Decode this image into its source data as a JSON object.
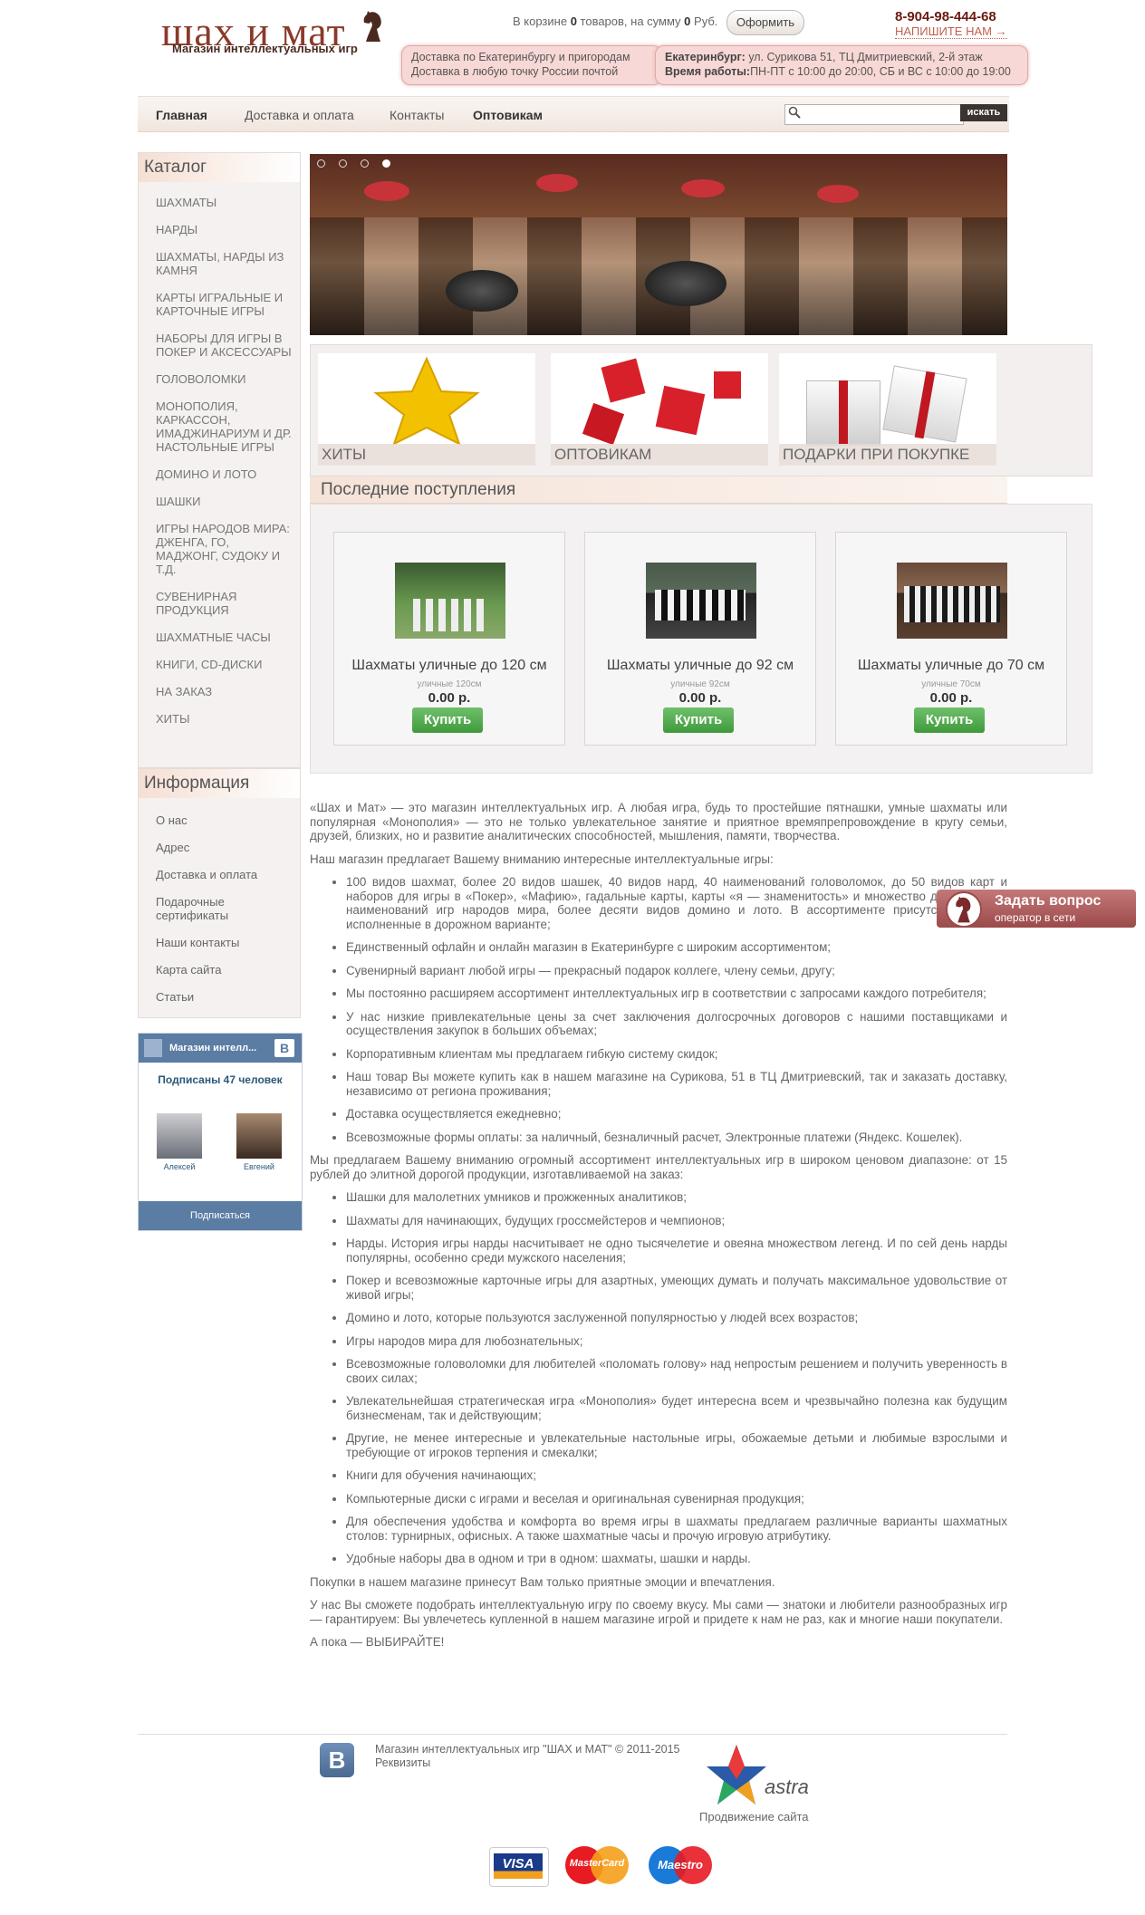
{
  "header": {
    "logo_title": "шах и мат",
    "logo_subtitle": "Магазин интеллектуальных игр",
    "cart_prefix": "В корзине ",
    "cart_count": "0",
    "cart_middle": " товаров, на сумму ",
    "cart_sum": "0",
    "cart_currency": " Руб.",
    "checkout": "Оформить",
    "phone": "8-904-98-444-68",
    "write_us": "Напишите нам →",
    "delivery_line1": "Доставка по Екатеринбургу и пригородам",
    "delivery_line2": "Доставка в любую точку России почтой",
    "address_label": "Екатеринбург:",
    "address": " ул. Сурикова 51, ТЦ Дмитриевский, 2-й этаж",
    "hours_label": "Время работы:",
    "hours": "ПН-ПТ с 10:00 до 20:00, СБ и ВС с 10:00 до 19:00"
  },
  "nav": {
    "items": [
      "Главная",
      "Доставка и оплата",
      "Контакты",
      "Оптовикам"
    ],
    "search_placeholder": "",
    "search_button": "искать"
  },
  "sidebar": {
    "catalog_title": "Каталог",
    "catalog": [
      "Шахматы",
      "Нарды",
      "Шахматы, нарды из камня",
      "Карты игральные и карточные игры",
      "Наборы для игры в покер и аксессуары",
      "Головоломки",
      "Монополия, Каркассон, Имаджинариум и др. настольные игры",
      "Домино и лото",
      "Шашки",
      "Игры народов мира: Дженга, Го, Маджонг, Судоку и т.д.",
      "Сувенирная продукция",
      "Шахматные часы",
      "Книги, CD-диски",
      "На заказ",
      "Хиты"
    ],
    "info_title": "Информация",
    "info": [
      "О нас",
      "Адрес",
      "Доставка и оплата",
      "Подарочные сертификаты",
      "Наши контакты",
      "Карта сайта",
      "Статьи"
    ],
    "vk": {
      "group": "Магазин интелл...",
      "subscribers": "Подписаны 47 человек",
      "user1": "Алексей",
      "user2": "Евгений",
      "subscribe": "Подписаться"
    }
  },
  "promos": [
    "Хиты",
    "Оптовикам",
    "Подарки при покупке"
  ],
  "latest": {
    "title": "Последние поступления",
    "products": [
      {
        "title": "Шахматы уличные до 120 см",
        "sub": "уличные 120см",
        "price": "0.00 р.",
        "buy": "Купить"
      },
      {
        "title": "Шахматы уличные до 92 см",
        "sub": "уличные 92см",
        "price": "0.00 р.",
        "buy": "Купить"
      },
      {
        "title": "Шахматы уличные до 70 см",
        "sub": "уличные 70см",
        "price": "0.00 р.",
        "buy": "Купить"
      }
    ]
  },
  "article": {
    "p1": "«Шах и Мат» — это магазин интеллектуальных игр. А любая игра, будь то простейшие пятнашки, умные шахматы или популярная «Монополия» — это не только увлекательное занятие и приятное времяпрепровождение в кругу семьи, друзей, близких, но и развитие аналитических способностей, мышления, памяти, творчества.",
    "p2": "Наш магазин предлагает Вашему вниманию интересные интеллектуальные игры:",
    "list1": [
      "100 видов шахмат, более 20 видов шашек, 40 видов нард, 40 наименований головоломок, до 50 видов карт и наборов для игры в «Покер», «Мафию», гадальные карты, карты «я — знаменитость» и множество других, до 20 наименований игр народов мира, более десяти видов домино и лото. В ассортименте присутствуют игры, исполненные в дорожном варианте;",
      "Единственный офлайн и онлайн магазин в Екатеринбурге с широким ассортиментом;",
      "Сувенирный вариант любой игры — прекрасный подарок коллеге, члену семьи, другу;",
      "Мы постоянно расширяем ассортимент интеллектуальных игр в соответствии с запросами каждого потребителя;",
      "У нас низкие привлекательные цены за счет заключения долгосрочных договоров с нашими поставщиками и осуществления закупок в больших объемах;",
      "Корпоративным клиентам мы предлагаем гибкую систему скидок;",
      "Наш товар Вы можете купить как в нашем магазине на Сурикова, 51 в ТЦ Дмитриевский, так и заказать доставку, независимо от региона проживания;",
      "Доставка осуществляется ежедневно;",
      "Всевозможные формы оплаты: за наличный, безналичный расчет, Электронные платежи (Яндекс. Кошелек)."
    ],
    "p3": "Мы предлагаем Вашему вниманию огромный ассортимент интеллектуальных игр в широком ценовом диапазоне: от 15 рублей до элитной дорогой продукции, изготавливаемой на заказ:",
    "list2": [
      "Шашки для малолетних умников и прожженных аналитиков;",
      "Шахматы для начинающих, будущих гроссмейстеров и чемпионов;",
      "Нарды. История игры нарды насчитывает не одно тысячелетие и овеяна множеством легенд. И по сей день нарды популярны, особенно среди мужского населения;",
      "Покер и всевозможные карточные игры для азартных, умеющих думать и получать максимальное удовольствие от живой игры;",
      "Домино и лото, которые пользуются заслуженной популярностью у людей всех возрастов;",
      "Игры народов мира для любознательных;",
      "Всевозможные головоломки для любителей «поломать голову» над непростым решением и получить уверенность в своих силах;",
      "Увлекательнейшая стратегическая игра «Монополия» будет интересна всем и чрезвычайно полезна как будущим бизнесменам, так и действующим;",
      "Другие, не менее интересные и увлекательные настольные игры, обожаемые детьми и любимые взрослыми и требующие от игроков терпения и смекалки;",
      "Книги для обучения начинающих;",
      "Компьютерные диски с играми и веселая и оригинальная сувенирная продукция;",
      "Для обеспечения удобства и комфорта во время игры в шахматы предлагаем различные варианты шахматных столов: турнирных, офисных. А также шахматные часы и прочую игровую атрибутику.",
      "Удобные наборы два в одном и три в одном: шахматы, шашки и нарды."
    ],
    "p4": "Покупки в нашем магазине принесут Вам только приятные эмоции и впечатления.",
    "p5": "У нас Вы сможете подобрать интеллектуальную игру по своему вкусу. Мы сами — знатоки и любители разнообразных игр — гарантируем: Вы увлечетесь купленной в нашем магазине игрой и придете к нам не раз, как и многие наши покупатели.",
    "p6": "А пока — ВЫБИРАЙТЕ!"
  },
  "ask": {
    "title": "Задать вопрос",
    "sub": "оператор в сети"
  },
  "footer": {
    "copyright": "Магазин интеллектуальных игр \"ШАХ и МАТ\" © 2011-2015",
    "requisites": "Реквизиты",
    "vk_letter": "В",
    "astra": "astra",
    "promo": "Продвижение сайта",
    "visa": "VISA",
    "mastercard": "MasterCard",
    "maestro": "Maestro"
  },
  "colors": {
    "accent": "#8a3a2a",
    "buy_green": "#4ea84a",
    "vk_blue": "#5b7ca3"
  }
}
